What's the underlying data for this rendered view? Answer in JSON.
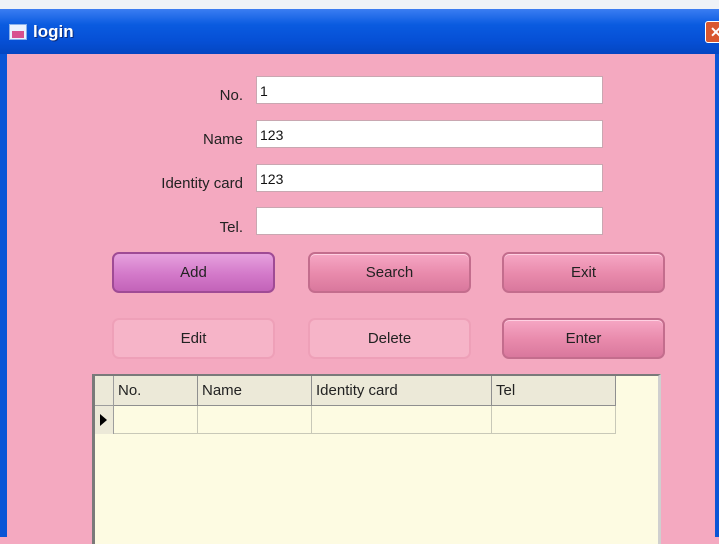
{
  "window": {
    "title": "login"
  },
  "form": {
    "no_label": "No.",
    "no_value": "1",
    "name_label": "Name",
    "name_value": "123",
    "identity_label": "Identity card",
    "identity_value": "123",
    "tel_label": "Tel.",
    "tel_value": ""
  },
  "buttons": {
    "add": "Add",
    "search": "Search",
    "exit": "Exit",
    "edit": "Edit",
    "delete": "Delete",
    "enter": "Enter"
  },
  "grid": {
    "columns": [
      "No.",
      "Name",
      "Identity card",
      "Tel"
    ],
    "rows": [
      [
        "",
        "",
        "",
        ""
      ]
    ]
  },
  "colors": {
    "background": "#f4a9c0",
    "titlebar": "#0650d6",
    "grid_background": "#fdfbe2"
  }
}
